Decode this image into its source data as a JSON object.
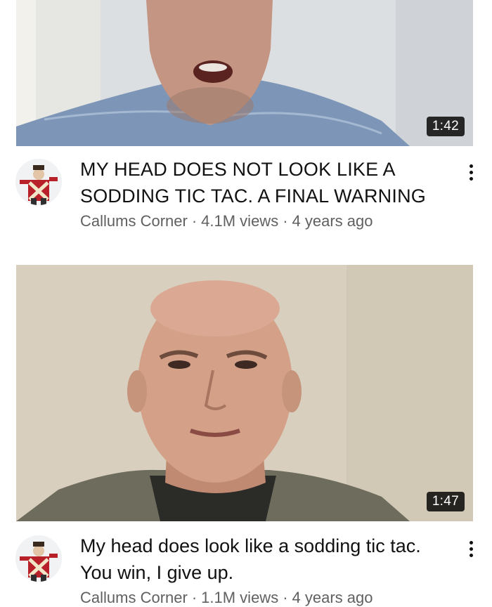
{
  "videos": [
    {
      "duration": "1:42",
      "title": "MY HEAD DOES NOT LOOK LIKE A SODDING TIC TAC. A FINAL WARNING",
      "channel": "Callums Corner",
      "views": "4.1M views",
      "age": "4 years ago"
    },
    {
      "duration": "1:47",
      "title": "My head does look like a sodding tic tac. You win, I give up.",
      "channel": "Callums Corner",
      "views": "1.1M views",
      "age": "4 years ago"
    }
  ],
  "separator": "·",
  "icons": {
    "more": "more-vert-icon"
  },
  "colors": {
    "text": "#0f0f0f",
    "secondary": "#606060",
    "badge_bg": "#000000"
  }
}
